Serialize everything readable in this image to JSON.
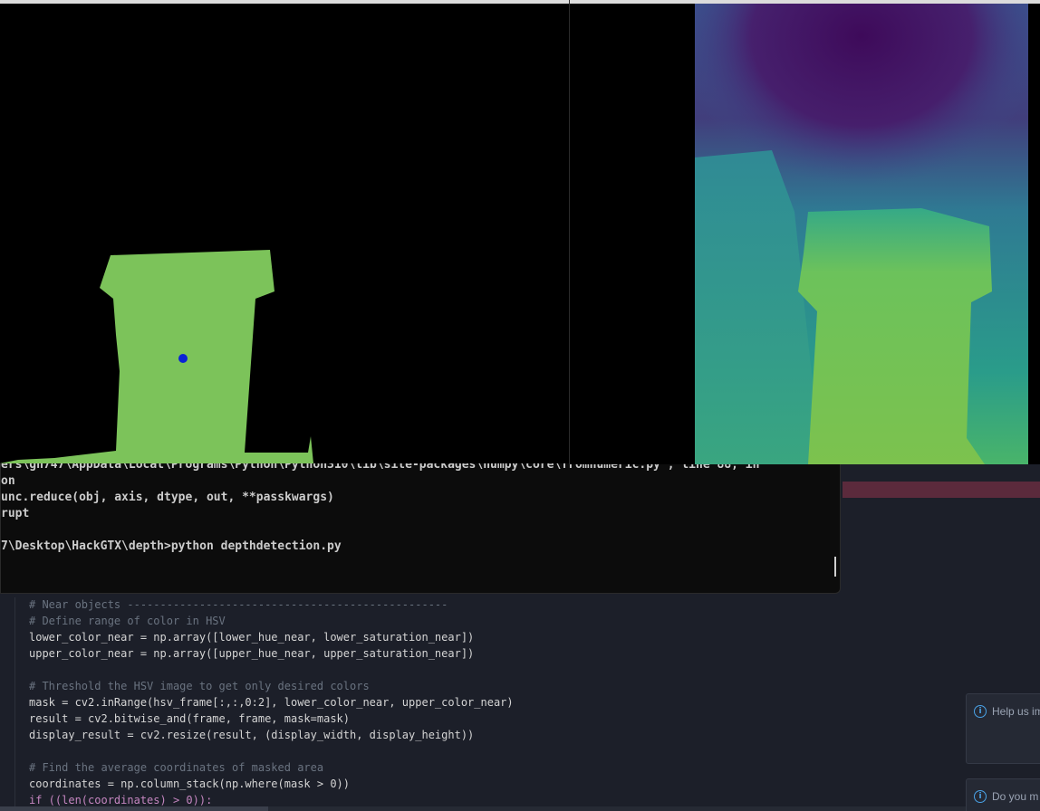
{
  "terminal": {
    "lines": [
      "ers\\gh747\\AppData\\Local\\Programs\\Python\\Python310\\lib\\site-packages\\numpy\\core\\fromnumeric.py\", line 88, in",
      "on",
      "unc.reduce(obj, axis, dtype, out, **passkwargs)",
      "rupt",
      "",
      "7\\Desktop\\HackGTX\\depth>python depthdetection.py"
    ]
  },
  "editor": {
    "line1": "# Near objects -------------------------------------------------",
    "line2": "# Define range of color in HSV",
    "line3": "lower_color_near = np.array([lower_hue_near, lower_saturation_near])",
    "line4": "upper_color_near = np.array([upper_hue_near, upper_saturation_near])",
    "line5": "# Threshold the HSV image to get only desired colors",
    "line6": "mask = cv2.inRange(hsv_frame[:,:,0:2], lower_color_near, upper_color_near)",
    "line7": "result = cv2.bitwise_and(frame, frame, mask=mask)",
    "line8": "display_result = cv2.resize(result, (display_width, display_height))",
    "line9": "# Find the average coordinates of masked area",
    "line10": "coordinates = np.column_stack(np.where(mask > 0))",
    "line11": "if ((len(coordinates) > 0)):"
  },
  "notifications": [
    {
      "icon": "info-icon",
      "text": "Help us im"
    },
    {
      "icon": "info-icon",
      "text": "Do you m"
    }
  ],
  "colors": {
    "mask_fill": "#7cc35a",
    "centroid": "#0a22d6",
    "editor_bg": "#1c1f29",
    "terminal_bg": "#0c0c0c"
  }
}
